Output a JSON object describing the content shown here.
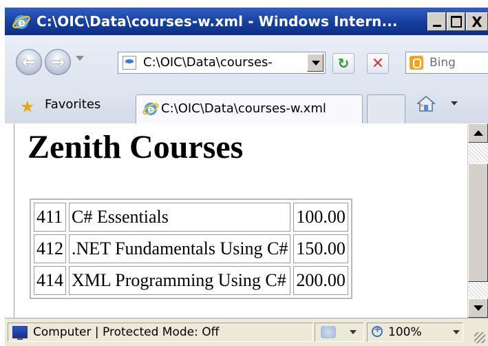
{
  "window": {
    "title": "C:\\OIC\\Data\\courses-w.xml - Windows Intern...",
    "min_label": "_",
    "close_label": "X"
  },
  "navigation": {
    "address": "C:\\OIC\\Data\\courses-",
    "search_placeholder": "Bing",
    "refresh_glyph": "↻",
    "stop_glyph": "✕"
  },
  "favorites_bar": {
    "favorites_label": "Favorites",
    "active_tab": "C:\\OIC\\Data\\courses-w.xml"
  },
  "page": {
    "heading": "Zenith Courses",
    "courses": [
      {
        "id": "411",
        "name": "C# Essentials",
        "price": "100.00"
      },
      {
        "id": "412",
        "name": ".NET Fundamentals Using C#",
        "price": "150.00"
      },
      {
        "id": "414",
        "name": "XML Programming Using C#",
        "price": "200.00"
      }
    ]
  },
  "status_bar": {
    "zone_text": "Computer | Protected Mode: Off",
    "zoom": "100%"
  },
  "colors": {
    "titlebar": "#163f9e",
    "favorites_star": "#e6a910",
    "bing": "#f7a21b"
  }
}
